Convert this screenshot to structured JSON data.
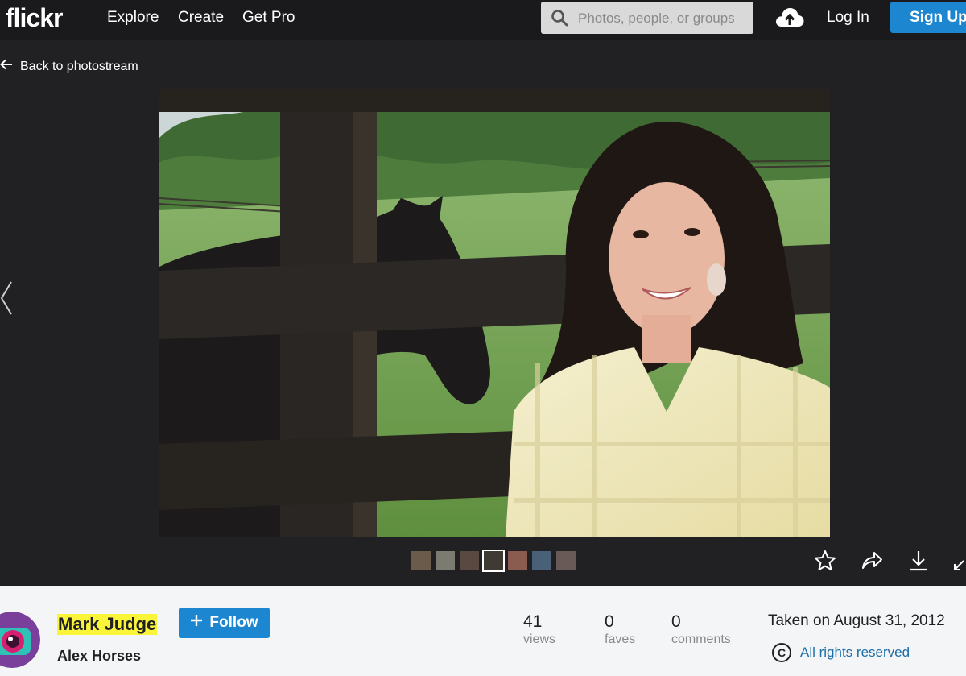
{
  "nav": {
    "logo": "flickr",
    "links": [
      "Explore",
      "Create",
      "Get Pro"
    ],
    "search_placeholder": "Photos, people, or groups",
    "login": "Log In",
    "signup": "Sign Up"
  },
  "back_link": "Back to photostream",
  "thumbnails_count": 7,
  "owner": {
    "name": "Mark Judge",
    "follow_label": "Follow"
  },
  "photo_title": "Alex Horses",
  "stats": [
    {
      "value": "41",
      "label": "views"
    },
    {
      "value": "0",
      "label": "faves"
    },
    {
      "value": "0",
      "label": "comments"
    }
  ],
  "taken": "Taken on August 31, 2012",
  "license": "All rights reserved",
  "icons": {
    "search": "search-icon",
    "upload": "cloud-upload-icon",
    "back": "arrow-left-icon",
    "prev": "chevron-left-icon",
    "fave": "star-icon",
    "share": "share-arrow-icon",
    "download": "download-icon",
    "expand": "expand-icon",
    "copyright": "copyright-icon"
  },
  "colors": {
    "accent": "#1c86d1",
    "highlight": "#fbf53a",
    "link": "#1c6fa9"
  }
}
